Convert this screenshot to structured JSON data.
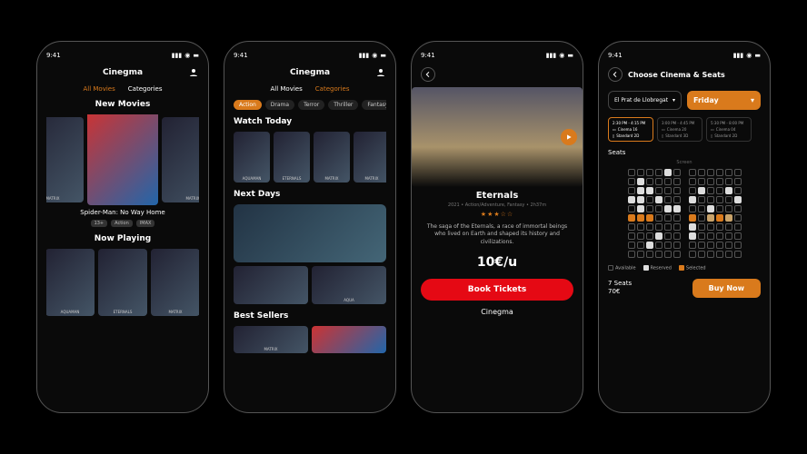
{
  "status": {
    "time": "9:41"
  },
  "brand": "Cinegma",
  "phone1": {
    "tabs": {
      "all": "All Movies",
      "cat": "Categories",
      "active": "all"
    },
    "section_new": "New Movies",
    "hero": "Spider-Man: No Way Home",
    "tags": [
      "13+",
      "Action",
      "IMAX"
    ],
    "section_now": "Now Playing",
    "posters_new": [
      "MATRIX",
      "",
      "MATRIX"
    ],
    "posters_now": [
      "AQUAMAN",
      "ETERNALS",
      "MATRIX"
    ]
  },
  "phone2": {
    "tabs": {
      "all": "All Movies",
      "cat": "Categories",
      "active": "cat"
    },
    "genres": [
      "Action",
      "Drama",
      "Terror",
      "Thriller",
      "Fantasy"
    ],
    "section_watch": "Watch Today",
    "section_next": "Next Days",
    "section_best": "Best Sellers",
    "posters_watch": [
      "AQUAMAN",
      "ETERNALS",
      "MATRIX",
      "MATRIX"
    ],
    "posters_bottom": [
      "",
      "AQUA"
    ],
    "best": [
      "MATRIX",
      ""
    ]
  },
  "phone3": {
    "title": "Eternals",
    "meta": "2021 • Action/Adventure, Fantasy • 2h37m",
    "stars": "★★★☆☆",
    "desc": "The saga of the Eternals, a race of immortal beings who lived on Earth and shaped its history and civilizations.",
    "price": "10€/u",
    "cta": "Book Tickets"
  },
  "phone4": {
    "title": "Choose Cinema & Seats",
    "cinema": "El Prat de Llobregat",
    "day": "Friday",
    "slots": [
      {
        "time": "2:30 PM - 4:15 PM",
        "room": "Cinema 16",
        "screen": "Standard 2D"
      },
      {
        "time": "3:00 PM - 4:45 PM",
        "room": "Cinema 20",
        "screen": "Standard 3D"
      },
      {
        "time": "5:30 PM - 8:00 PM",
        "room": "Cinema 04",
        "screen": "Standard 2D"
      }
    ],
    "seats_label": "Seats",
    "screen": "Screen",
    "legend": {
      "a": "Available",
      "r": "Reserved",
      "s": "Selected"
    },
    "summary": {
      "count": "7 Seats",
      "total": "70€"
    },
    "buy": "Buy Now",
    "grid": [
      [
        [
          "",
          "",
          "",
          "",
          "r",
          ""
        ],
        [
          "",
          "",
          "",
          "",
          "",
          ""
        ]
      ],
      [
        [
          "",
          "r",
          "",
          "",
          "",
          ""
        ],
        [
          "",
          "",
          "",
          "",
          "",
          ""
        ]
      ],
      [
        [
          "",
          "r",
          "r",
          "",
          "",
          ""
        ],
        [
          "",
          "r",
          "",
          "",
          "r",
          ""
        ]
      ],
      [
        [
          "r",
          "r",
          "",
          "r",
          "",
          ""
        ],
        [
          "r",
          "",
          "",
          "",
          "",
          "r"
        ]
      ],
      [
        [
          "",
          "r",
          "",
          "",
          "r",
          "r"
        ],
        [
          "",
          "",
          "r",
          "",
          "",
          ""
        ]
      ],
      [
        [
          "s",
          "s",
          "s",
          "",
          "",
          ""
        ],
        [
          "s",
          "",
          "s2",
          "s",
          "s2",
          ""
        ]
      ],
      [
        [
          "",
          "",
          "",
          "",
          "",
          ""
        ],
        [
          "r",
          "",
          "",
          "",
          "",
          ""
        ]
      ],
      [
        [
          "",
          "",
          "",
          "r",
          "",
          ""
        ],
        [
          "r",
          "",
          "",
          "",
          "",
          ""
        ]
      ],
      [
        [
          "",
          "",
          "r",
          "",
          "",
          ""
        ],
        [
          "",
          "",
          "",
          "",
          "",
          ""
        ]
      ],
      [
        [
          "",
          "",
          "",
          "",
          "",
          ""
        ],
        [
          "",
          "",
          "",
          "",
          "",
          ""
        ]
      ]
    ]
  }
}
